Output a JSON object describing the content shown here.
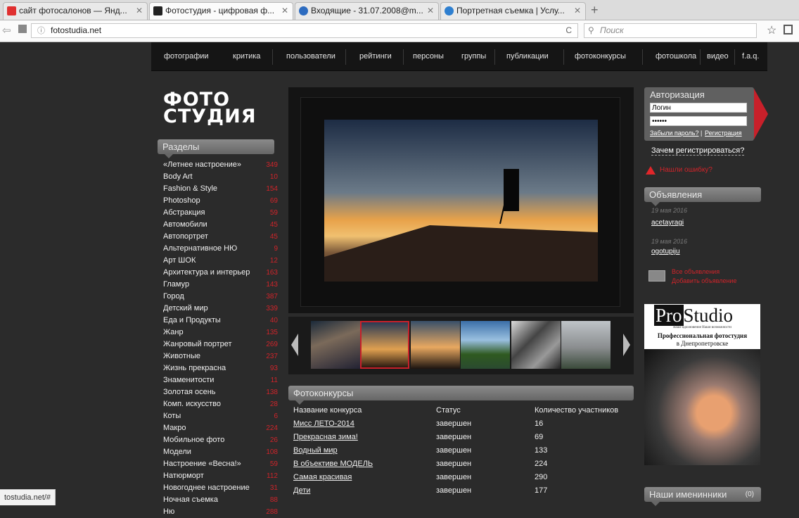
{
  "browser": {
    "tabs": [
      {
        "label": "сайт фотосалонов — Янд...",
        "icon_color": "#e03030",
        "active": false
      },
      {
        "label": "Фотостудия - цифровая ф...",
        "icon_color": "#222222",
        "active": true
      },
      {
        "label": "Входящие - 31.07.2008@m...",
        "icon_color": "#2d6cc0",
        "active": false
      },
      {
        "label": "Портретная съемка | Услу...",
        "icon_color": "#2e7fd0",
        "active": false
      }
    ],
    "new_tab_symbol": "+",
    "url": "fotostudia.net",
    "search_placeholder": "Поиск",
    "reload_symbol": "C"
  },
  "menu": [
    "фотографии",
    "критика",
    "пользователи",
    "рейтинги",
    "персоны",
    "группы",
    "публикации",
    "фотоконкурсы",
    "фотошкола",
    "видео",
    "f.a.q."
  ],
  "logo": {
    "line1": "ФОТО",
    "line2": "СТУДИЯ"
  },
  "sections": {
    "title": "Разделы",
    "items": [
      {
        "label": "«Летнее настроение»",
        "count": "349"
      },
      {
        "label": "Body Art",
        "count": "10"
      },
      {
        "label": "Fashion & Style",
        "count": "154"
      },
      {
        "label": "Photoshop",
        "count": "69"
      },
      {
        "label": "Абстракция",
        "count": "59"
      },
      {
        "label": "Автомобили",
        "count": "45"
      },
      {
        "label": "Автопортрет",
        "count": "45"
      },
      {
        "label": "Альтернативное НЮ",
        "count": "9"
      },
      {
        "label": "Арт ШОК",
        "count": "12"
      },
      {
        "label": "Архитектура и интерьер",
        "count": "163"
      },
      {
        "label": "Гламур",
        "count": "143"
      },
      {
        "label": "Город",
        "count": "387"
      },
      {
        "label": "Детский мир",
        "count": "339"
      },
      {
        "label": "Еда и Продукты",
        "count": "40"
      },
      {
        "label": "Жанр",
        "count": "135"
      },
      {
        "label": "Жанровый портрет",
        "count": "269"
      },
      {
        "label": "Животные",
        "count": "237"
      },
      {
        "label": "Жизнь прекрасна",
        "count": "93"
      },
      {
        "label": "Знаменитости",
        "count": "11"
      },
      {
        "label": "Золотая осень",
        "count": "138"
      },
      {
        "label": "Комп. искусство",
        "count": "28"
      },
      {
        "label": "Коты",
        "count": "6"
      },
      {
        "label": "Макро",
        "count": "224"
      },
      {
        "label": "Мобильное фото",
        "count": "26"
      },
      {
        "label": "Модели",
        "count": "108"
      },
      {
        "label": "Настроение «Весна!»",
        "count": "59"
      },
      {
        "label": "Натюрморт",
        "count": "112"
      },
      {
        "label": "Новогоднее настроение",
        "count": "31"
      },
      {
        "label": "Ночная съемка",
        "count": "88"
      },
      {
        "label": "Ню",
        "count": "288"
      }
    ]
  },
  "contests": {
    "title": "Фотоконкурсы",
    "headers": [
      "Название конкурса",
      "Статус",
      "Количество участников"
    ],
    "rows": [
      {
        "name": "Мисс ЛЕТО-2014",
        "status": "завершен",
        "count": "16"
      },
      {
        "name": "Прекрасная зима!",
        "status": "завершен",
        "count": "69"
      },
      {
        "name": "Водный мир",
        "status": "завершен",
        "count": "133"
      },
      {
        "name": "В объективе МОДЕЛЬ",
        "status": "завершен",
        "count": "224"
      },
      {
        "name": "Самая красивая",
        "status": "завершен",
        "count": "290"
      },
      {
        "name": "Дети",
        "status": "завершен",
        "count": "177"
      }
    ]
  },
  "auth": {
    "title": "Авторизация",
    "login_value": "Логин",
    "password_value": "••••••",
    "forgot": "Забыли пароль?",
    "sep": "|",
    "register": "Регистрация",
    "why": "Зачем регистрироваться?"
  },
  "error_link": "Нашли ошибку?",
  "ads": {
    "title": "Объявления",
    "items": [
      {
        "date": "19 мая 2016",
        "user": "acetayragi"
      },
      {
        "date": "19 мая 2016",
        "user": "ogotupiju"
      }
    ],
    "all": "Все объявления",
    "add": "Добавить объявление"
  },
  "banner": {
    "pro": "Pro",
    "studio": "Studio",
    "tagline": "Ваше вдохновение  Наши возможности",
    "line1": "Профессиональная фотостудия",
    "line2": "в Днепропетровске"
  },
  "birthdays": {
    "title": "Наши именинники",
    "count": "(0)"
  },
  "status_bar": "tostudia.net/#"
}
